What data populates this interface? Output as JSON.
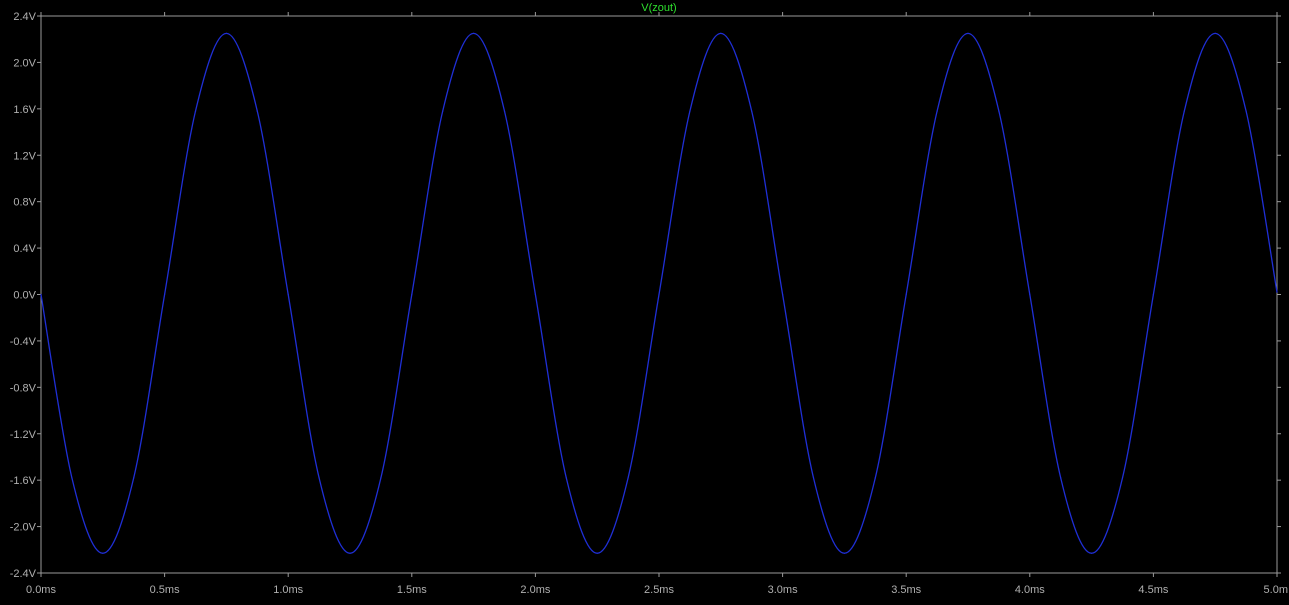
{
  "chart_data": {
    "type": "line",
    "title": "V(zout)",
    "xlabel": "",
    "ylabel": "",
    "xlim": [
      0,
      5.0
    ],
    "ylim": [
      -2.4,
      2.4
    ],
    "grid": false,
    "x_ticks": [
      0,
      0.5,
      1.0,
      1.5,
      2.0,
      2.5,
      3.0,
      3.5,
      4.0,
      4.5,
      5.0
    ],
    "x_tick_labels": [
      "0.0ms",
      "0.5ms",
      "1.0ms",
      "1.5ms",
      "2.0ms",
      "2.5ms",
      "3.0ms",
      "3.5ms",
      "4.0ms",
      "4.5ms",
      "5.0m"
    ],
    "y_ticks": [
      2.4,
      2.0,
      1.6,
      1.2,
      0.8,
      0.4,
      0.0,
      -0.4,
      -0.8,
      -1.2,
      -1.6,
      -2.0,
      -2.4
    ],
    "y_tick_labels": [
      "2.4V",
      "2.0V",
      "1.6V",
      "1.2V",
      "0.8V",
      "0.4V",
      "0.0V",
      "-0.4V",
      "-0.8V",
      "-1.2V",
      "-1.6V",
      "-2.0V",
      "-2.4V"
    ],
    "series": [
      {
        "name": "V(zout)",
        "color": "#1f2fd6",
        "x": [
          0,
          0.125,
          0.25,
          0.375,
          0.5,
          0.625,
          0.75,
          0.875,
          1.0,
          1.125,
          1.25,
          1.375,
          1.5,
          1.625,
          1.75,
          1.875,
          2.0,
          2.125,
          2.25,
          2.375,
          2.5,
          2.625,
          2.75,
          2.875,
          3.0,
          3.125,
          3.25,
          3.375,
          3.5,
          3.625,
          3.75,
          3.875,
          4.0,
          4.125,
          4.25,
          4.375,
          4.5,
          4.625,
          4.75,
          4.875,
          5.0
        ],
        "values": [
          0.0,
          -1.58,
          -2.23,
          -1.58,
          0.0,
          1.58,
          2.25,
          1.58,
          0.0,
          -1.58,
          -2.23,
          -1.58,
          0.0,
          1.58,
          2.25,
          1.58,
          0.0,
          -1.58,
          -2.23,
          -1.58,
          0.0,
          1.58,
          2.25,
          1.58,
          0.0,
          -1.58,
          -2.23,
          -1.58,
          0.0,
          1.58,
          2.25,
          1.58,
          0.0,
          -1.58,
          -2.23,
          -1.58,
          0.0,
          1.58,
          2.25,
          1.58,
          0.02
        ]
      }
    ]
  },
  "colors": {
    "background": "#000000",
    "frame": "#9a9a9a",
    "tick_label": "#b0b0b0",
    "title": "#2ee02e",
    "trace": "#1f2fd6"
  }
}
